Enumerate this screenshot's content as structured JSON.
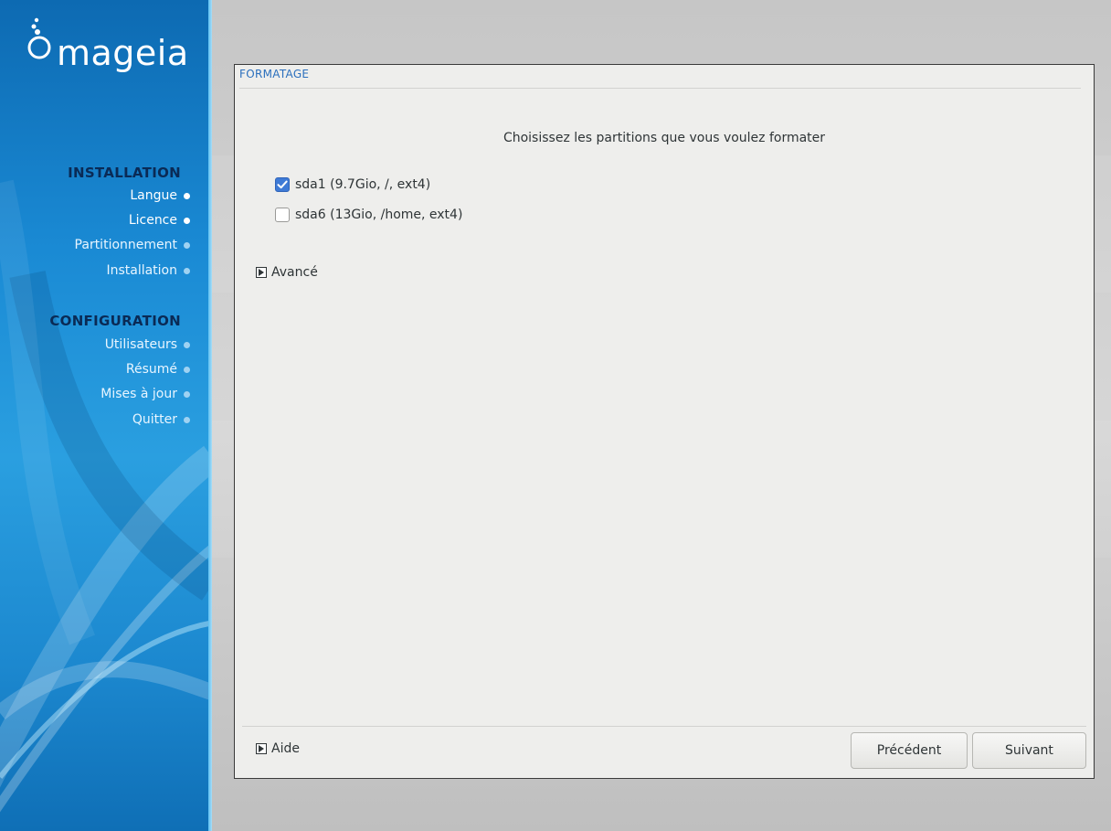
{
  "sidebar": {
    "logo_text": "mageia",
    "sections": [
      {
        "title": "INSTALLATION",
        "items": [
          {
            "label": "Langue",
            "state": "done"
          },
          {
            "label": "Licence",
            "state": "done"
          },
          {
            "label": "Partitionnement",
            "state": "pending"
          },
          {
            "label": "Installation",
            "state": "pending"
          }
        ]
      },
      {
        "title": "CONFIGURATION",
        "items": [
          {
            "label": "Utilisateurs",
            "state": "pending"
          },
          {
            "label": "Résumé",
            "state": "pending"
          },
          {
            "label": "Mises à jour",
            "state": "pending"
          },
          {
            "label": "Quitter",
            "state": "pending"
          }
        ]
      }
    ]
  },
  "dialog": {
    "title": "FORMATAGE",
    "instruction": "Choisissez les partitions que vous voulez formater",
    "partitions": [
      {
        "label": "sda1 (9.7Gio, /, ext4)",
        "checked": true
      },
      {
        "label": "sda6 (13Gio, /home, ext4)",
        "checked": false
      }
    ],
    "advanced_label": "Avancé",
    "help_label": "Aide",
    "buttons": {
      "previous": "Précédent",
      "next": "Suivant"
    }
  },
  "colors": {
    "accent": "#3e7ad6",
    "title": "#2a6fbd",
    "sidebar": "#1a8ad4"
  }
}
